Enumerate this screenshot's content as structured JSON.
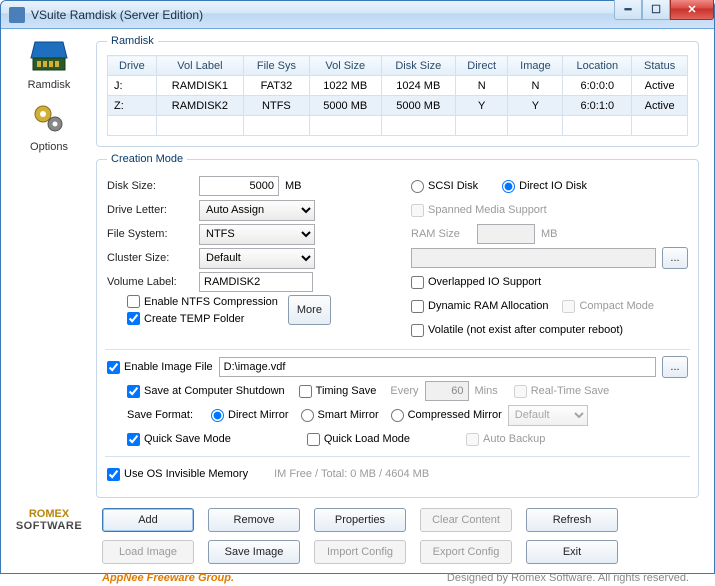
{
  "window": {
    "title": "VSuite Ramdisk (Server Edition)"
  },
  "sidebar": {
    "tabs": [
      {
        "label": "Ramdisk"
      },
      {
        "label": "Options"
      }
    ],
    "logo": {
      "line1": "ROMEX",
      "line2": "SOFTWARE"
    }
  },
  "ramdisk_group": {
    "legend": "Ramdisk",
    "headers": [
      "Drive",
      "Vol Label",
      "File Sys",
      "Vol Size",
      "Disk Size",
      "Direct",
      "Image",
      "Location",
      "Status"
    ],
    "rows": [
      {
        "drive": "J:",
        "vol_label": "RAMDISK1",
        "fs": "FAT32",
        "vol_size": "1022 MB",
        "disk_size": "1024 MB",
        "direct": "N",
        "image": "N",
        "loc": "6:0:0:0",
        "status": "Active"
      },
      {
        "drive": "Z:",
        "vol_label": "RAMDISK2",
        "fs": "NTFS",
        "vol_size": "5000 MB",
        "disk_size": "5000 MB",
        "direct": "Y",
        "image": "Y",
        "loc": "6:0:1:0",
        "status": "Active"
      }
    ]
  },
  "creation": {
    "legend": "Creation Mode",
    "disk_size_lbl": "Disk Size:",
    "disk_size_val": "5000",
    "disk_size_unit": "MB",
    "scsi": "SCSI Disk",
    "directio": "Direct IO Disk",
    "drive_letter_lbl": "Drive Letter:",
    "drive_letter_val": "Auto Assign",
    "spanned": "Spanned Media Support",
    "fs_lbl": "File System:",
    "fs_val": "NTFS",
    "ram_size_lbl": "RAM Size",
    "ram_size_unit": "MB",
    "cluster_lbl": "Cluster Size:",
    "cluster_val": "Default",
    "ellipsis": "...",
    "volume_lbl": "Volume Label:",
    "volume_val": "RAMDISK2",
    "overlapped": "Overlapped IO Support",
    "enable_ntfs": "Enable NTFS Compression",
    "dynamic": "Dynamic RAM Allocation",
    "compact": "Compact Mode",
    "create_temp": "Create TEMP Folder",
    "more": "More",
    "volatile": "Volatile (not exist after computer reboot)",
    "enable_image": "Enable Image File",
    "image_path": "D:\\image.vdf",
    "save_shutdown": "Save at Computer Shutdown",
    "timing_save": "Timing Save",
    "every": "Every",
    "every_val": "60",
    "mins": "Mins",
    "realtime": "Real-Time Save",
    "save_format": "Save Format:",
    "direct_mirror": "Direct Mirror",
    "smart_mirror": "Smart Mirror",
    "compressed_mirror": "Compressed Mirror",
    "default_level": "Default",
    "quick_save": "Quick Save Mode",
    "quick_load": "Quick Load Mode",
    "auto_backup": "Auto Backup",
    "use_os_invisible": "Use OS Invisible Memory",
    "im_info": "IM Free / Total: 0 MB / 4604 MB"
  },
  "buttons": {
    "add": "Add",
    "remove": "Remove",
    "properties": "Properties",
    "clear": "Clear Content",
    "refresh": "Refresh",
    "load_img": "Load Image",
    "save_img": "Save Image",
    "import_cfg": "Import Config",
    "export_cfg": "Export Config",
    "exit": "Exit"
  },
  "footer": {
    "left": "AppNee Freeware Group.",
    "right": "Designed by Romex Software. All rights reserved."
  }
}
